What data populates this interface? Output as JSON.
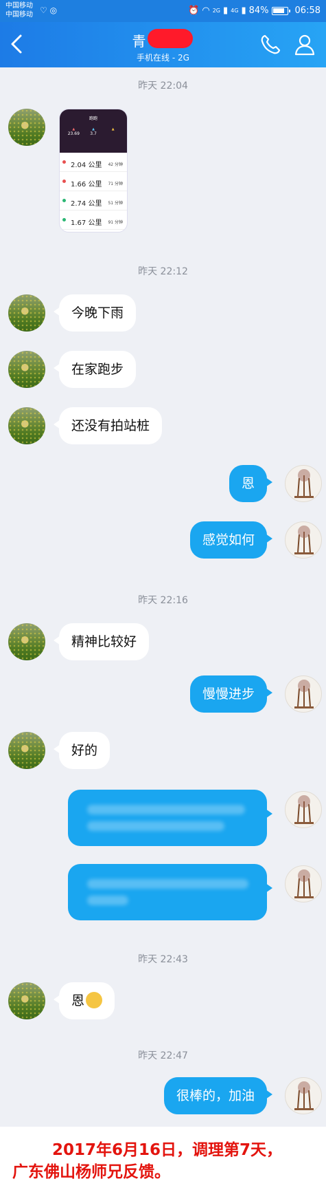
{
  "status_bar": {
    "carrier1": "中国移动",
    "carrier2": "中国移动",
    "net1": "2G",
    "net2": "4G",
    "battery": "84%",
    "battery_level": 0.84,
    "clock": "06:58"
  },
  "header": {
    "title": "青",
    "subtitle": "手机在线 - 2G"
  },
  "shared_screenshot": {
    "title": "跑跑",
    "stats": [
      "23.69",
      "3.7",
      ""
    ],
    "rows": [
      {
        "dist": "2.04",
        "unit": "公里",
        "mins": "42 分钟",
        "color": "#e85050"
      },
      {
        "dist": "1.66",
        "unit": "公里",
        "mins": "71 分钟",
        "color": "#e85050"
      },
      {
        "dist": "2.74",
        "unit": "公里",
        "mins": "51 分钟",
        "color": "#2bb673"
      },
      {
        "dist": "1.67",
        "unit": "公里",
        "mins": "91 分钟",
        "color": "#2bb673"
      }
    ]
  },
  "timestamps": [
    "昨天 22:04",
    "昨天 22:12",
    "昨天 22:16",
    "昨天 22:43",
    "昨天 22:47"
  ],
  "messages": {
    "m1": "今晚下雨",
    "m2": "在家跑步",
    "m3": "还没有拍站桩",
    "m4": "恩",
    "m5": "感觉如何",
    "m6": "精神比较好",
    "m7": "慢慢进步",
    "m8": "好的",
    "m11": "恩",
    "m12": "很棒的，加油"
  },
  "caption": {
    "line1": "2017年6月16日，调理第7天，",
    "line2": "广东佛山杨师兄反馈。"
  }
}
